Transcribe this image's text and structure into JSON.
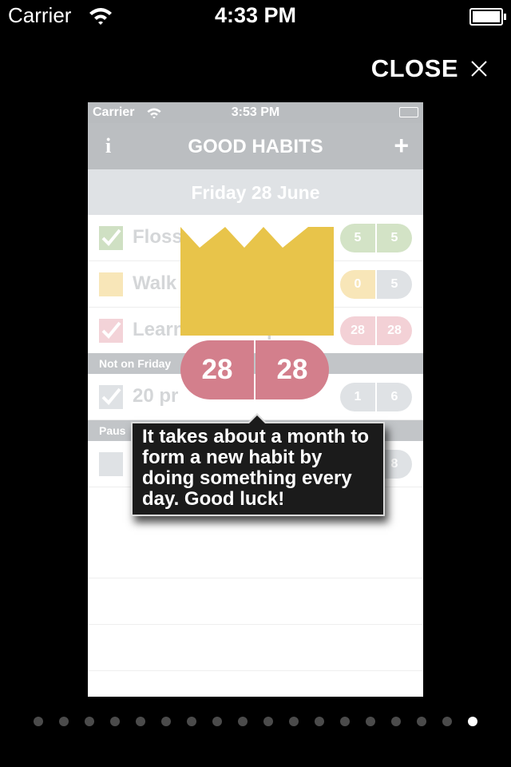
{
  "status": {
    "carrier": "Carrier",
    "time": "4:33 PM"
  },
  "close": {
    "label": "CLOSE",
    "icon": "close-icon"
  },
  "screenshot": {
    "status": {
      "carrier": "Carrier",
      "time": "3:53 PM"
    },
    "nav": {
      "title": "GOOD HABITS",
      "info": "i",
      "add": "+"
    },
    "date": "Friday 28 June",
    "habits": [
      {
        "label": "Floss",
        "checked": true,
        "box": "#cfe0c3",
        "check": "#b6d0a2",
        "left": "5",
        "right": "5",
        "leftColor": "#d3e3c6",
        "rightColor": "#d3e3c6"
      },
      {
        "label": "Walk the dog",
        "checked": false,
        "box": "#f8e6b8",
        "check": "",
        "left": "0",
        "right": "5",
        "leftColor": "#f8e6b8",
        "rightColor": "#dfe2e5"
      },
      {
        "label": "Learn the trumpet",
        "checked": true,
        "box": "#f3d3d8",
        "check": "#eab4bc",
        "left": "28",
        "right": "28",
        "leftColor": "#f3d1d6",
        "rightColor": "#f3d1d6"
      }
    ],
    "section1": "Not on Friday",
    "habits2": [
      {
        "label": "20 pr",
        "checked": true,
        "box": "#dfe2e5",
        "check": "#c8ccd0",
        "left": "1",
        "right": "6",
        "leftColor": "#dfe2e5",
        "rightColor": "#dfe2e5"
      }
    ],
    "section2": "Paus",
    "habits3": [
      {
        "label": "",
        "checked": false,
        "box": "#dfe2e5",
        "check": "",
        "left": "",
        "right": "8",
        "leftColor": "#dfe2e5",
        "rightColor": "#dfe2e5"
      }
    ],
    "counter": {
      "left": "28",
      "right": "28"
    },
    "tooltip": "It takes about a month to form a new habit by doing something every day. Good luck!"
  },
  "colors": {
    "crown": "#e8c44a",
    "counter": "#d37f8c",
    "tooltipBg": "#1b1b1b"
  },
  "pager": {
    "count": 18,
    "current": 18
  }
}
